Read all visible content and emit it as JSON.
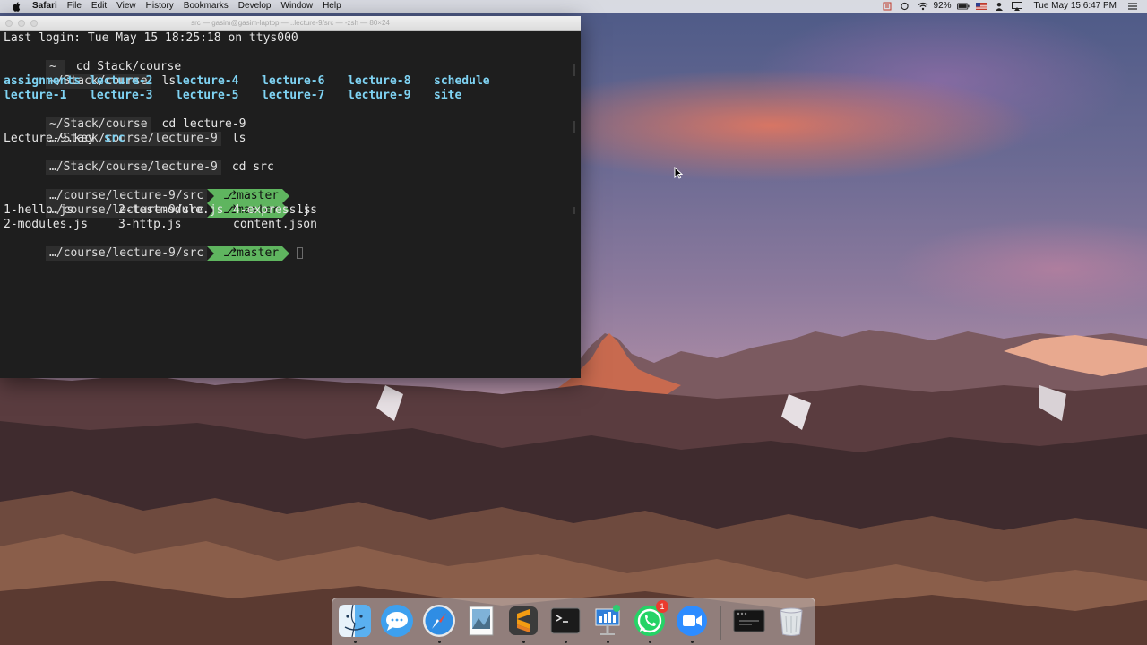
{
  "menubar": {
    "app_name": "Safari",
    "menus": [
      "File",
      "Edit",
      "View",
      "History",
      "Bookmarks",
      "Develop",
      "Window",
      "Help"
    ],
    "battery": "92%",
    "clock": "Tue May 15  6:47 PM"
  },
  "terminal": {
    "title": "src — gasim@gasim-laptop — ..lecture-9/src — -zsh — 80×24",
    "login_line": "Last login: Tue May 15 18:25:18 on ttys000",
    "prompt1": {
      "path": "~",
      "command": "cd Stack/course"
    },
    "prompt2": {
      "path": "~/Stack/course",
      "command": "ls"
    },
    "ls1_dirs": [
      "assignments",
      "lecture-2",
      "lecture-4",
      "lecture-6",
      "lecture-8",
      "schedule",
      "lecture-1",
      "lecture-3",
      "lecture-5",
      "lecture-7",
      "lecture-9",
      "site"
    ],
    "prompt3": {
      "path": "~/Stack/course",
      "command": "cd lecture-9"
    },
    "prompt4": {
      "path": "…/Stack/course/lecture-9",
      "command": "ls"
    },
    "ls2_file": "Lecture-9.key",
    "ls2_dir": "src",
    "prompt5": {
      "path": "…/Stack/course/lecture-9",
      "command": "cd src"
    },
    "prompt6": {
      "path": "…/course/lecture-9/src",
      "branch": "master"
    },
    "prompt7": {
      "path": "…/course/lecture-9/src",
      "branch": "master",
      "command": "ls"
    },
    "ls3_files": [
      "1-hello.js",
      "2-testmodule.js",
      "4-express.js",
      "2-modules.js",
      "3-http.js",
      "content.json"
    ],
    "prompt8": {
      "path": "…/course/lecture-9/src",
      "branch": "master"
    }
  },
  "dock": {
    "items": [
      "Finder",
      "Messages",
      "Safari",
      "Preview",
      "Sublime Text",
      "Terminal",
      "Keynote",
      "WhatsApp",
      "Zoom",
      "Screen Recording",
      "Trash"
    ],
    "whatsapp_badge": "1"
  }
}
